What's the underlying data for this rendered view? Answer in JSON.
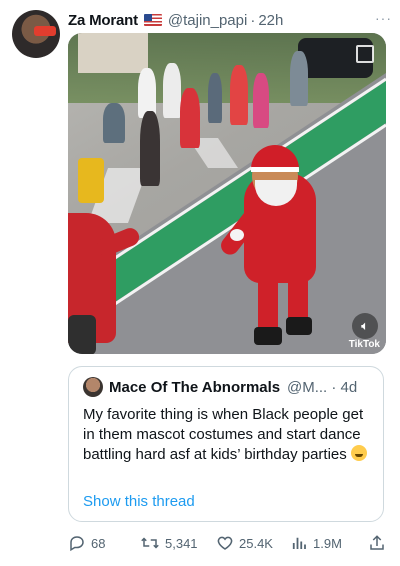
{
  "tweet": {
    "author_name": "Za Morant",
    "handle": "@tajin_papi",
    "separator": "·",
    "time": "22h",
    "more_label": "···"
  },
  "video": {
    "watermark": "TikTok"
  },
  "quote": {
    "author_name": "Macе Of The Abnormals",
    "handle_time": "@M... · 4d",
    "text": "My favorite thing is when Black people get in them mascot costumes and start dance battling hard asf at kids’ birthday parties",
    "emoji": "laughing-crying-emoji",
    "show_thread": "Show this thread"
  },
  "actions": {
    "replies": "68",
    "retweets": "5,341",
    "likes": "25.4K",
    "views": "1.9M"
  },
  "colors": {
    "link": "#1d9bf0",
    "muted": "#536471",
    "bike_lane": "#2f9d62"
  }
}
